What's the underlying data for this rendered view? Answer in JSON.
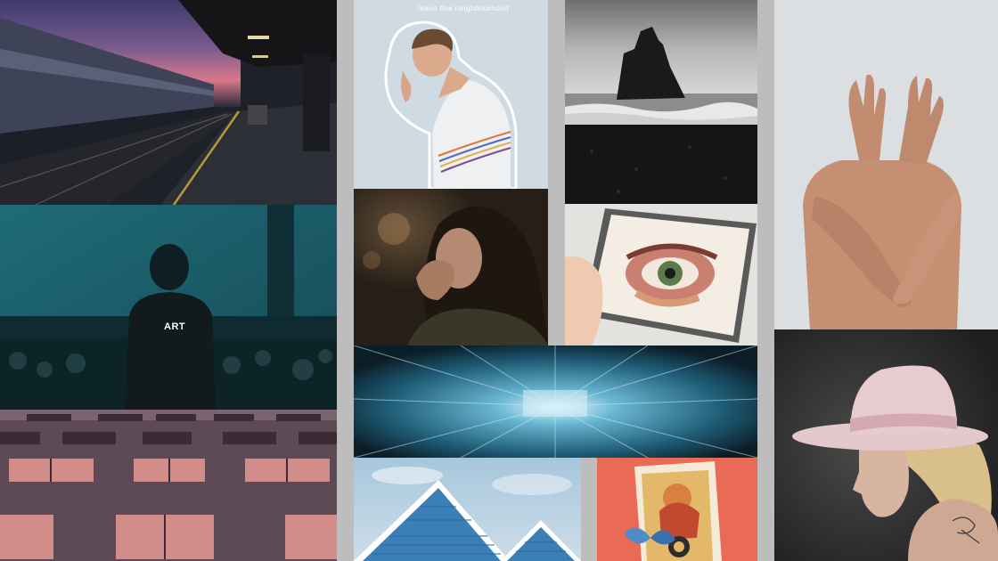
{
  "collage": {
    "art_label": "ART",
    "boy_caption": "leave this neighbourhood"
  },
  "tiles": [
    {
      "name": "train-platform-dusk-photo"
    },
    {
      "name": "silhouette-person-teal-photo"
    },
    {
      "name": "building-facade-pink-windows-photo"
    },
    {
      "name": "boy-striped-shirt-photo"
    },
    {
      "name": "sea-stack-black-beach-photo"
    },
    {
      "name": "woman-contemplative-photo"
    },
    {
      "name": "eye-painting-in-frame-photo"
    },
    {
      "name": "tunnel-motion-blur-photo"
    },
    {
      "name": "blue-rooftops-photo"
    },
    {
      "name": "tarot-card-collage-photo"
    },
    {
      "name": "hands-over-torso-photo"
    },
    {
      "name": "woman-pink-hat-photo"
    }
  ]
}
